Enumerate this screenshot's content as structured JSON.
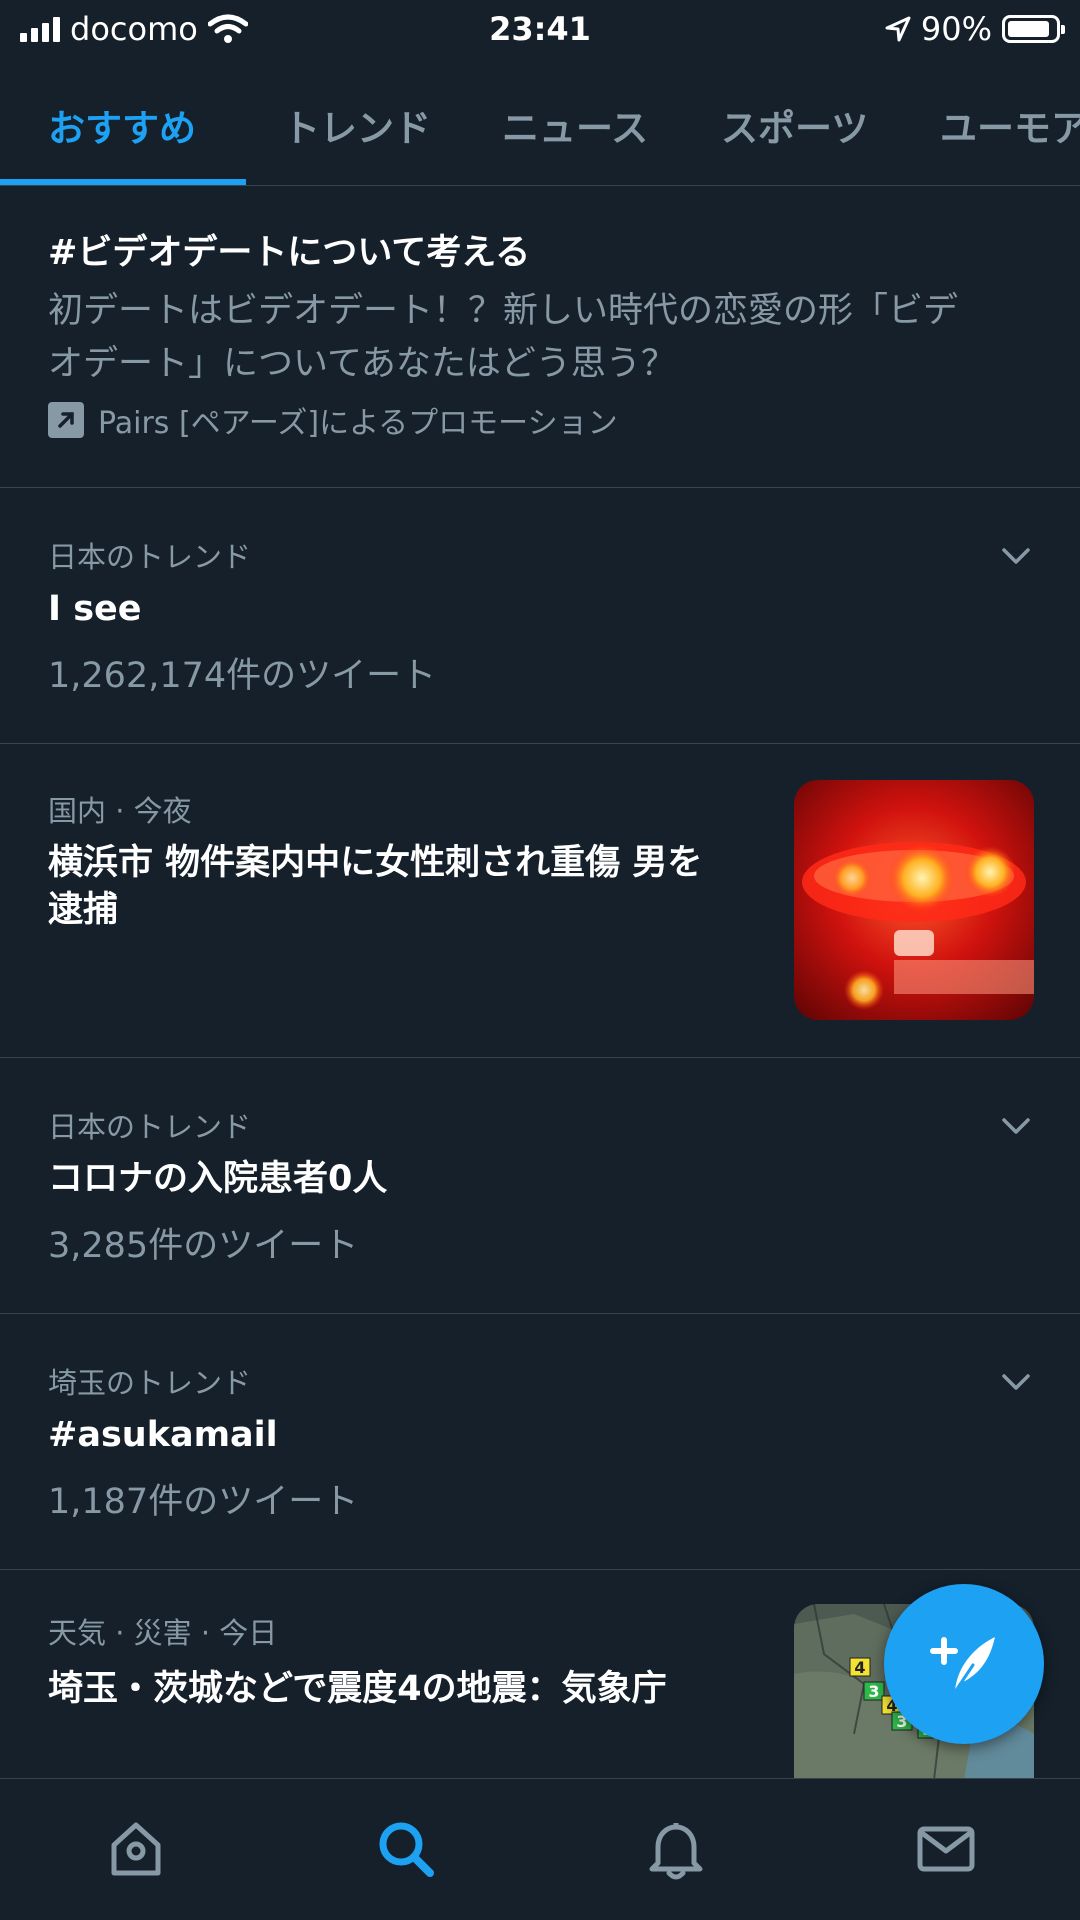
{
  "status_bar": {
    "carrier": "docomo",
    "time": "23:41",
    "battery_text": "90%",
    "battery_level": 0.9
  },
  "tabs": [
    {
      "label": "おすすめ",
      "active": true
    },
    {
      "label": "トレンド",
      "active": false
    },
    {
      "label": "ニュース",
      "active": false
    },
    {
      "label": "スポーツ",
      "active": false
    },
    {
      "label": "ユーモア",
      "active": false
    }
  ],
  "promo": {
    "title": "#ビデオデートについて考える",
    "desc_line1": "初デートはビデオデート！？新しい時代の恋愛の形「ビデ",
    "desc_line2": "オデート」についてあなたはどう思う？",
    "promoted_by": "Pairs [ペアーズ]によるプロモーション",
    "icon": "promoted-arrow-icon"
  },
  "items": [
    {
      "meta": "日本のトレンド",
      "title": "I see",
      "count": "1,262,174件のツイート"
    },
    {
      "meta": "国内 · 今夜",
      "title_line1": "横浜市 物件案内中に女性刺され重傷 男を",
      "title_line2": "逮捕",
      "image": "police-siren-photo"
    },
    {
      "meta": "日本のトレンド",
      "title": "コロナの入院患者0人",
      "count": "3,285件のツイート"
    },
    {
      "meta": "埼玉のトレンド",
      "title": "#asukamail",
      "count": "1,187件のツイート"
    },
    {
      "meta": "天気 · 災害 · 今日",
      "title": "埼玉・茨城などで震度4の地震：気象庁",
      "image": "earthquake-map-thumbnail"
    }
  ],
  "map_badges": [
    "4",
    "3",
    "4",
    "3",
    "3"
  ],
  "colors": {
    "background": "#15202b",
    "accent": "#1da1f2",
    "secondary_text": "#8899a6",
    "divider": "#38444d"
  },
  "bottom_nav": [
    "home-icon",
    "search-icon",
    "notifications-icon",
    "messages-icon"
  ]
}
